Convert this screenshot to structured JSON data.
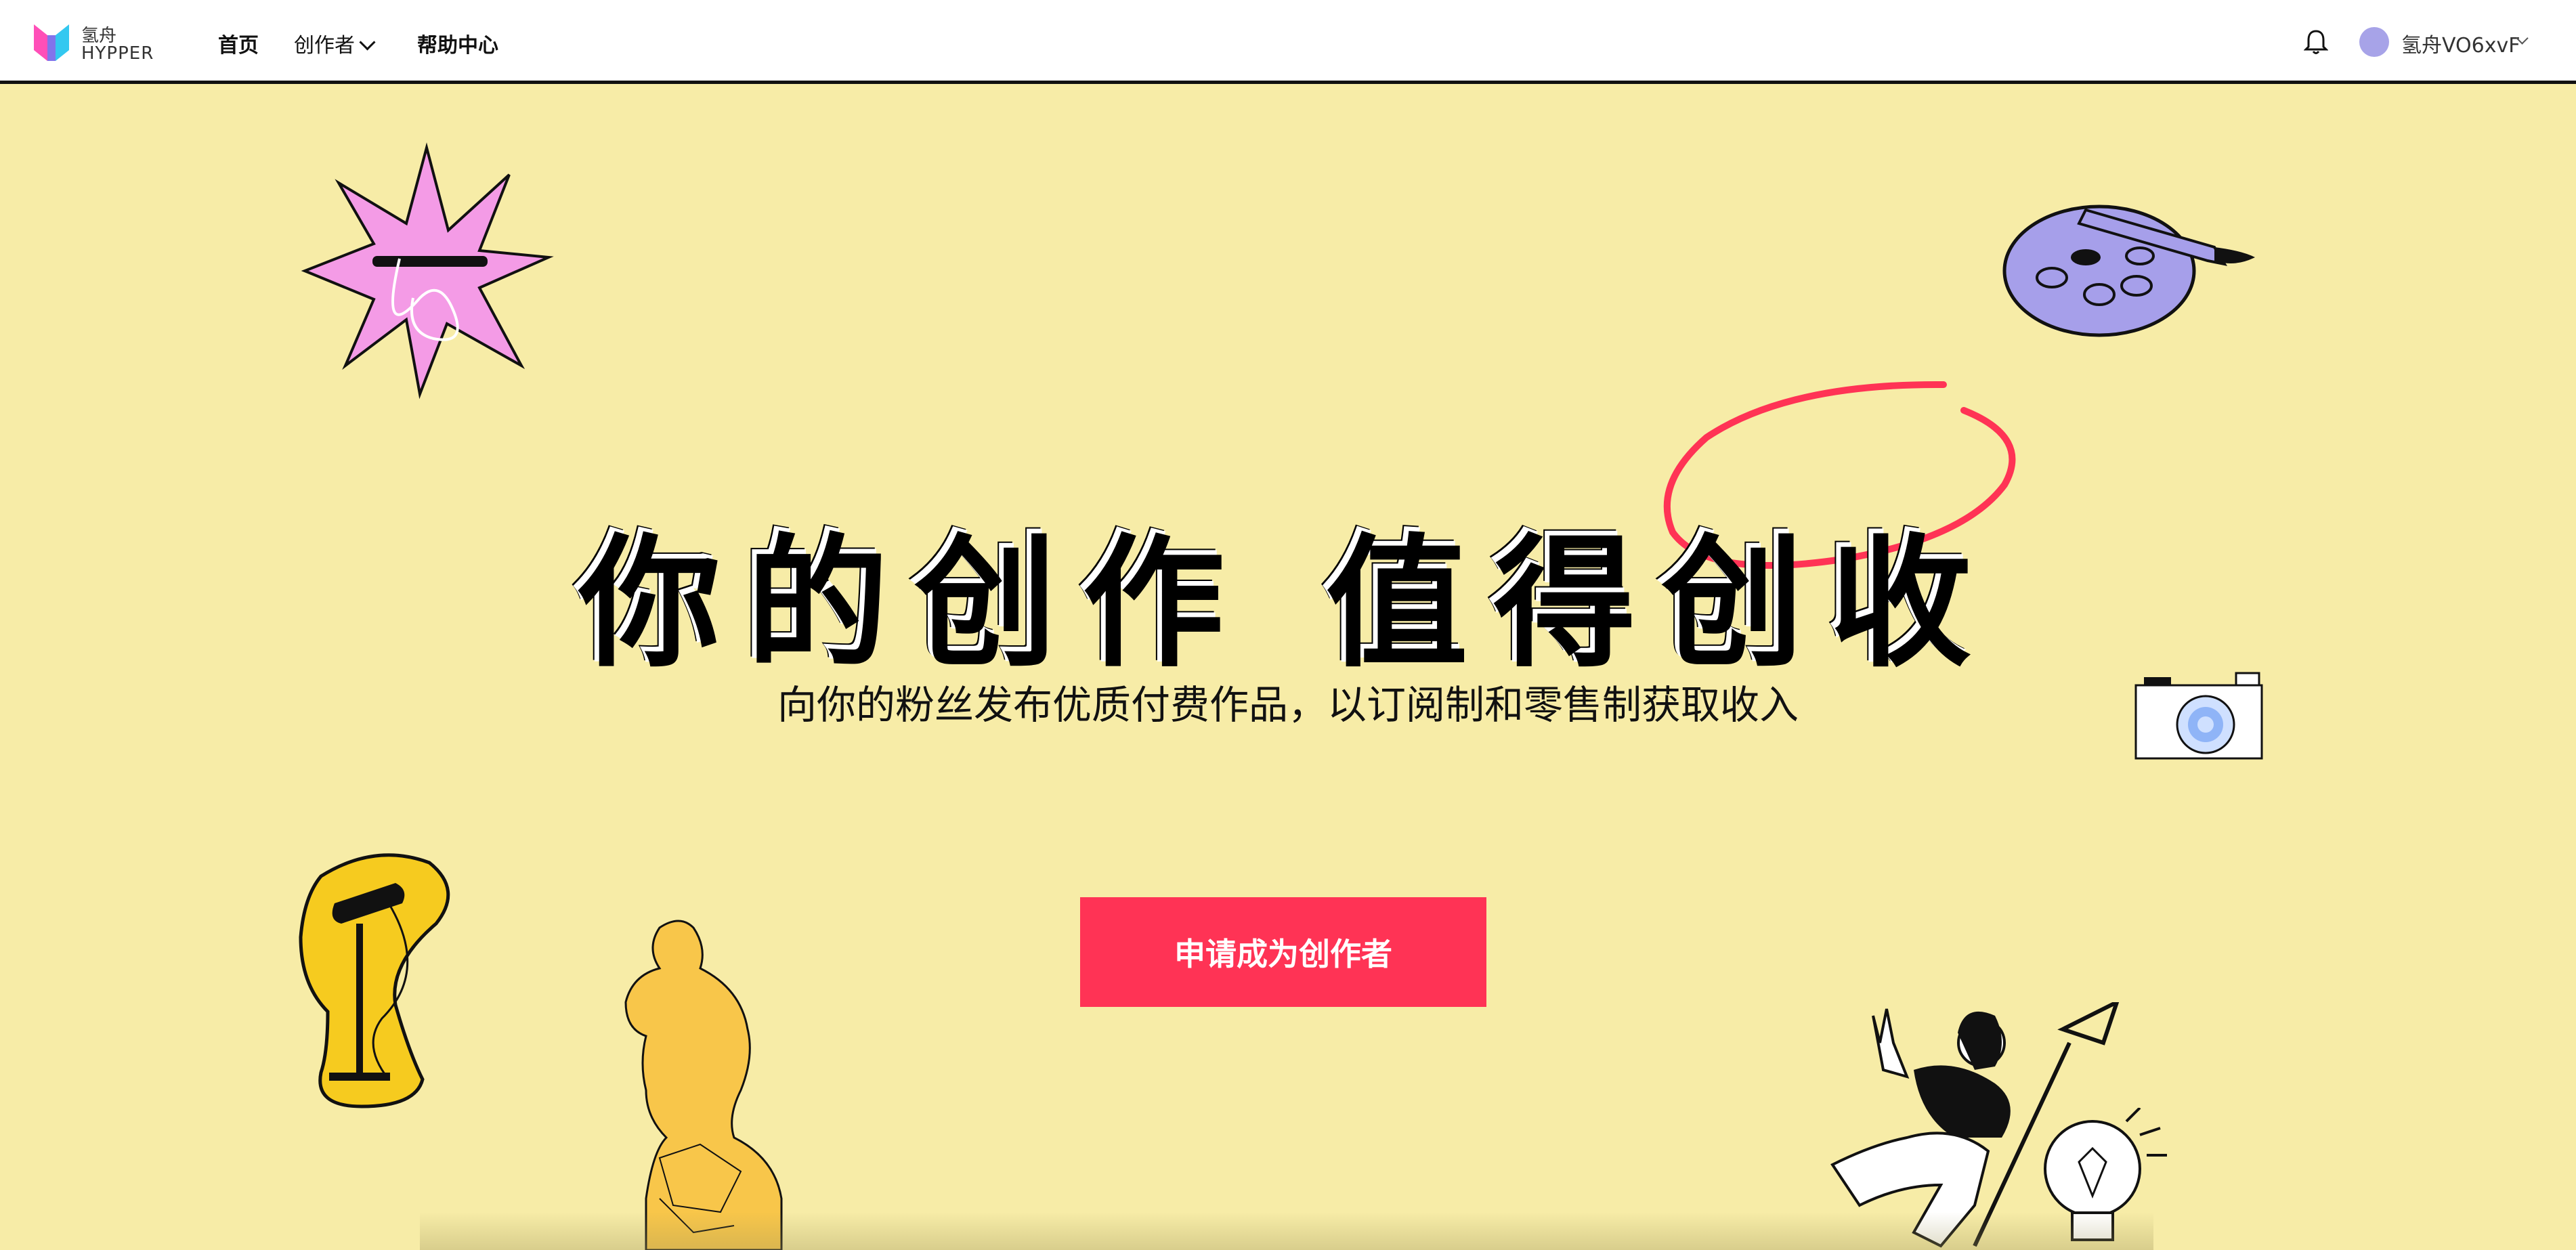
{
  "header": {
    "logo_cn": "氢舟",
    "logo_en": "HYPPER",
    "nav": {
      "home": "首页",
      "creator": "创作者",
      "help": "帮助中心"
    },
    "user_name": "氢舟VO6xvF"
  },
  "hero": {
    "headline": "你的创作 值得创收",
    "subtitle": "向你的粉丝发布优质付费作品，以订阅制和零售制获取收入",
    "cta_label": "申请成为创作者"
  },
  "colors": {
    "background": "#F7ECA7",
    "accent": "#FF3355",
    "header_bg": "#FFFFFF"
  },
  "icons": [
    "logo-icon",
    "bell-icon",
    "avatar",
    "star-burst-illustration",
    "palette-illustration",
    "camera-illustration",
    "microphone-illustration",
    "statue-illustration",
    "creator-figure-illustration",
    "lightbulb-illustration"
  ]
}
